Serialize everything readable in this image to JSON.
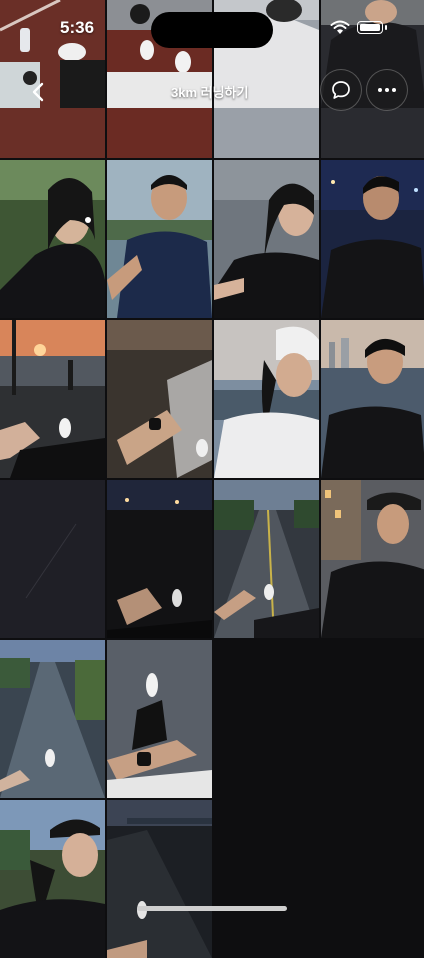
{
  "status_bar": {
    "time": "5:36"
  },
  "header": {
    "title": "3km 러닝하기",
    "back_icon": "chevron-left-icon",
    "chat_icon": "chat-bubble-icon",
    "more_icon": "more-horizontal-icon"
  },
  "colors": {
    "background": "#0e0e10",
    "placeholder_tile": "#1f1f26"
  },
  "photos": [
    {
      "id": "p1",
      "scene": "track-shoes"
    },
    {
      "id": "p2",
      "scene": "track-watch"
    },
    {
      "id": "p3",
      "scene": "white-jacket"
    },
    {
      "id": "p4",
      "scene": "dark-jacket-man"
    },
    {
      "id": "p5",
      "scene": "woman-park-selfie"
    },
    {
      "id": "p6",
      "scene": "man-river-selfie"
    },
    {
      "id": "p7",
      "scene": "woman-black-tee"
    },
    {
      "id": "p8",
      "scene": "man-night-lights"
    },
    {
      "id": "p9",
      "scene": "sunset-path-feet"
    },
    {
      "id": "p10",
      "scene": "crosswalk-watch"
    },
    {
      "id": "p11",
      "scene": "woman-white-cap"
    },
    {
      "id": "p12",
      "scene": "man-river-city"
    },
    {
      "id": "p13",
      "scene": "loading-placeholder"
    },
    {
      "id": "p14",
      "scene": "dark-road-feet"
    },
    {
      "id": "p15",
      "scene": "wet-road-hand"
    },
    {
      "id": "p16",
      "scene": "man-cap-building"
    },
    {
      "id": "p17",
      "scene": "wet-road-shoes"
    },
    {
      "id": "p18",
      "scene": "pov-legs-watch"
    },
    {
      "id": "p19",
      "scene": "woman-cap-trees"
    },
    {
      "id": "p20",
      "scene": "night-river-feet"
    }
  ]
}
